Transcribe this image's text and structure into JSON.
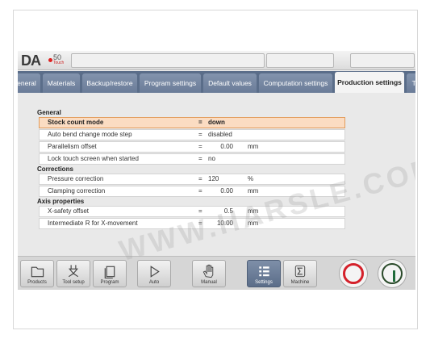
{
  "header": {
    "logo_text": "DA",
    "logo_number": "50",
    "logo_sub": "Touch"
  },
  "tabs": [
    {
      "label": "eneral",
      "active": false
    },
    {
      "label": "Materials",
      "active": false
    },
    {
      "label": "Backup/restore",
      "active": false
    },
    {
      "label": "Program settings",
      "active": false
    },
    {
      "label": "Default values",
      "active": false
    },
    {
      "label": "Computation settings",
      "active": false
    },
    {
      "label": "Production settings",
      "active": true
    },
    {
      "label": "Ti",
      "active": false
    }
  ],
  "groups": {
    "general": "General",
    "corrections": "Corrections",
    "axis": "Axis properties"
  },
  "rows": [
    {
      "label": "Stock count mode",
      "eq": "=",
      "value": "down",
      "unit": "",
      "selected": true
    },
    {
      "label": "Auto bend change mode step",
      "eq": "=",
      "value": "disabled",
      "unit": "",
      "selected": false
    },
    {
      "label": "Parallelism offset",
      "eq": "=",
      "value": "0.00",
      "unit": "mm",
      "selected": false
    },
    {
      "label": "Lock touch screen when started",
      "eq": "=",
      "value": "no",
      "unit": "",
      "selected": false
    },
    {
      "label": "Pressure correction",
      "eq": "=",
      "value": "120",
      "unit": "%",
      "selected": false
    },
    {
      "label": "Clamping correction",
      "eq": "=",
      "value": "0.00",
      "unit": "mm",
      "selected": false
    },
    {
      "label": "X-safety offset",
      "eq": "=",
      "value": "0.5",
      "unit": "mm",
      "selected": false
    },
    {
      "label": "Intermediate R for X-movement",
      "eq": "=",
      "value": "10.00",
      "unit": "mm",
      "selected": false
    }
  ],
  "watermark": "WWW.HARSLE.COM",
  "bottom_buttons": [
    {
      "label": "Products",
      "icon": "folder-icon",
      "active": false
    },
    {
      "label": "Tool setup",
      "icon": "punch-tool-icon",
      "active": false
    },
    {
      "label": "Program",
      "icon": "program-pages-icon",
      "active": false
    },
    {
      "label": "Auto",
      "icon": "play-triangle-icon",
      "active": false
    },
    {
      "label": "Manual",
      "icon": "hand-icon",
      "active": false
    },
    {
      "label": "Settings",
      "icon": "settings-list-icon",
      "active": true
    },
    {
      "label": "Machine",
      "icon": "sigma-icon",
      "active": false
    }
  ],
  "colors": {
    "tab_bar": "#5a6d89",
    "active_tab": "#f4f4f4",
    "selected_row": "#fbdcc2",
    "stop": "#d4202a",
    "start": "#1f6b3a"
  }
}
